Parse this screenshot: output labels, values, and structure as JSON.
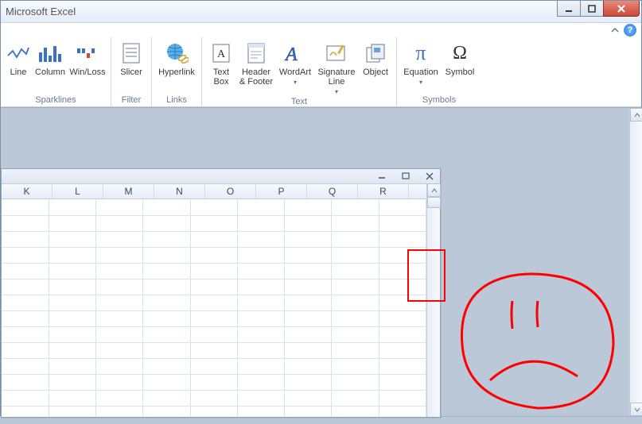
{
  "window": {
    "title": "Microsoft Excel",
    "help_glyph": "?"
  },
  "ribbon": {
    "groups": [
      {
        "label": "Sparklines",
        "buttons": [
          {
            "label": "Line"
          },
          {
            "label": "Column"
          },
          {
            "label": "Win/Loss"
          }
        ]
      },
      {
        "label": "Filter",
        "buttons": [
          {
            "label": "Slicer"
          }
        ]
      },
      {
        "label": "Links",
        "buttons": [
          {
            "label": "Hyperlink"
          }
        ]
      },
      {
        "label": "Text",
        "buttons": [
          {
            "label": "Text\nBox"
          },
          {
            "label": "Header\n& Footer"
          },
          {
            "label": "WordArt",
            "dropdown": true
          },
          {
            "label": "Signature\nLine",
            "dropdown": true
          },
          {
            "label": "Object"
          }
        ]
      },
      {
        "label": "Symbols",
        "buttons": [
          {
            "label": "Equation",
            "dropdown": true
          },
          {
            "label": "Symbol"
          }
        ]
      }
    ]
  },
  "child_columns": [
    "K",
    "L",
    "M",
    "N",
    "O",
    "P",
    "Q",
    "R"
  ],
  "symbols": {
    "pi": "π",
    "omega": "Ω"
  }
}
